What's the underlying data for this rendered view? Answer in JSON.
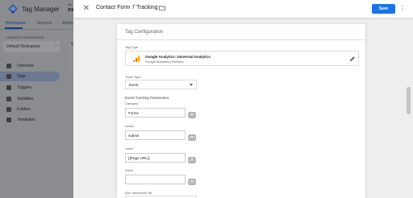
{
  "background_app": {
    "product": "Tag Manager",
    "account_small": "All",
    "account": "ex",
    "tabs": [
      "Workspace",
      "Versions",
      "Admin"
    ],
    "workspace_label": "CURRENT WORKSPACE",
    "workspace_name": "Default Workspace",
    "peek_letter": "N",
    "nav": [
      {
        "label": "Overview",
        "active": false
      },
      {
        "label": "Tags",
        "active": true
      },
      {
        "label": "Triggers",
        "active": false
      },
      {
        "label": "Variables",
        "active": false
      },
      {
        "label": "Folders",
        "active": false
      },
      {
        "label": "Templates",
        "active": false
      }
    ]
  },
  "panel": {
    "close_glyph": "✕",
    "title": "Contact Form 7 Tracking",
    "save_label": "Save",
    "more_glyph": "⋮"
  },
  "card": {
    "title": "Tag Configuration",
    "tag_type_label": "Tag Type",
    "tag_type_name": "Google Analytics: Universal Analytics",
    "tag_type_sub": "Google Marketing Platform",
    "track_type_label": "Track Type",
    "track_type_value": "Event",
    "params_label": "Event Tracking Parameters",
    "fields": [
      {
        "label": "Category",
        "value": "Forms"
      },
      {
        "label": "Action",
        "value": "submit"
      },
      {
        "label": "Label",
        "value": "{{Page URL}}"
      },
      {
        "label": "Value",
        "value": ""
      }
    ],
    "non_interaction_label": "Non-Interaction Hit"
  },
  "colors": {
    "accent": "#1a73e8",
    "analytics_orange": "#f9ab00",
    "analytics_dark": "#e37400"
  }
}
